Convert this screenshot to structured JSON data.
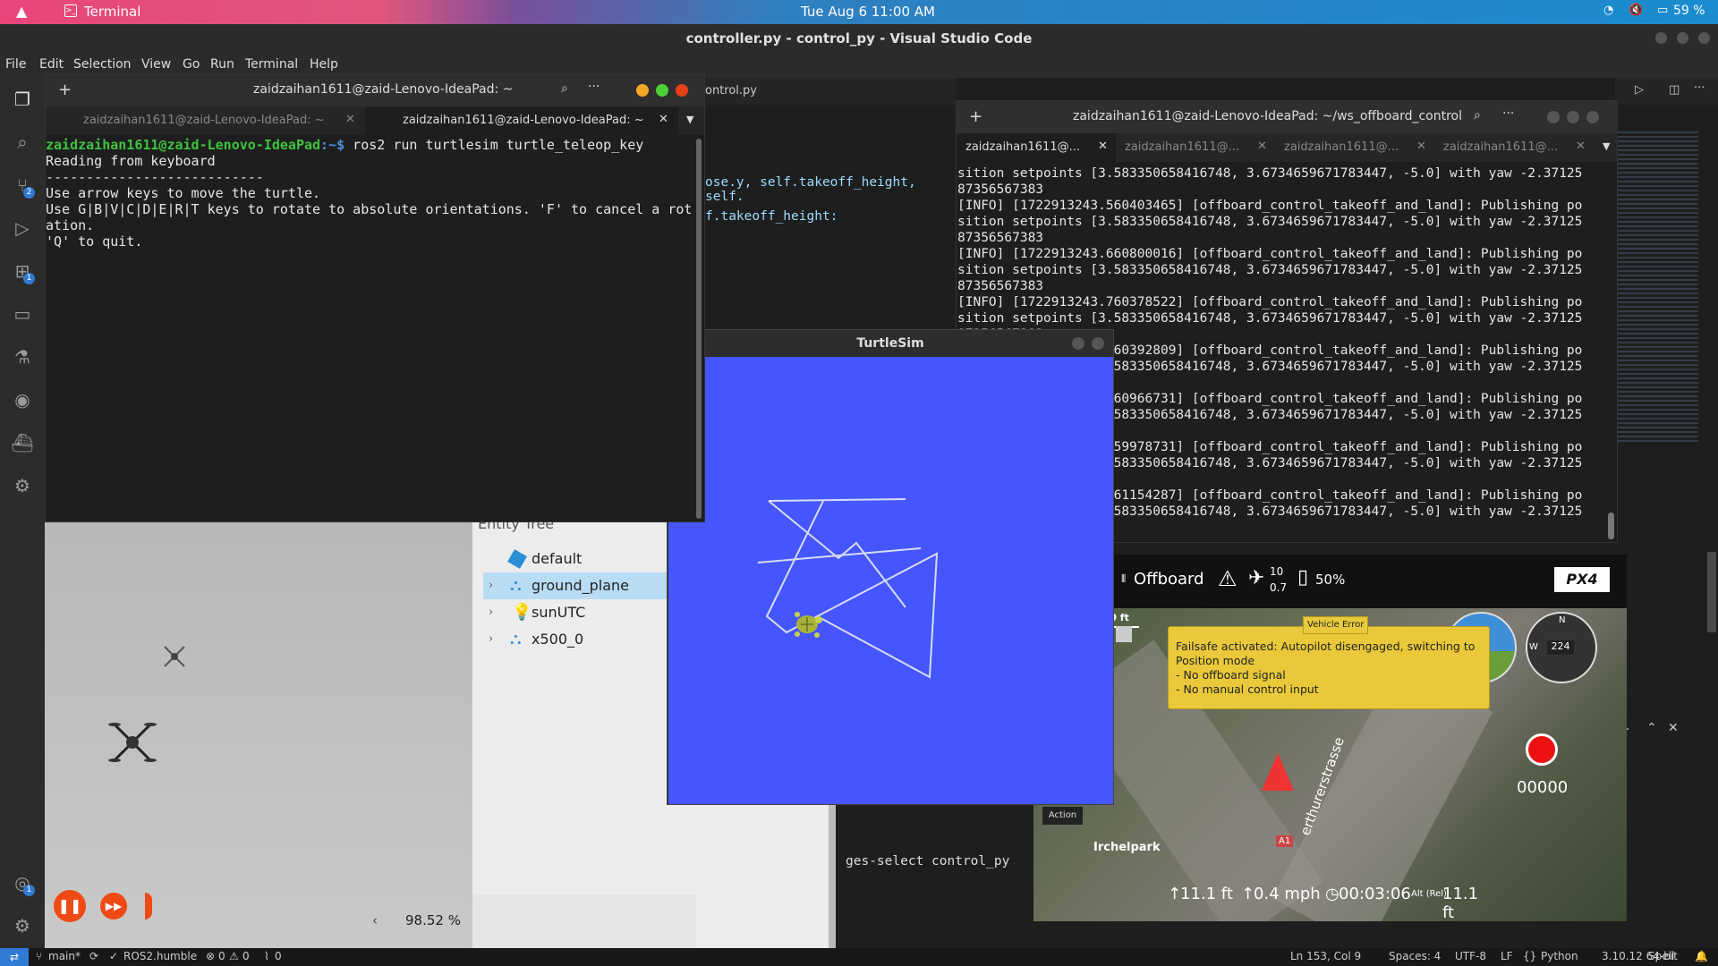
{
  "topbar": {
    "app_name": "Terminal",
    "clock": "Tue Aug 6  11:00 AM",
    "battery": "59 %"
  },
  "vscode": {
    "title": "controller.py - control_py - Visual Studio Code",
    "menu": [
      "File",
      "Edit",
      "Selection",
      "View",
      "Go",
      "Run",
      "Terminal",
      "Help"
    ],
    "tab_partial": "ontrol.py",
    "code_line1": "ose.y, self.takeoff_height, self.",
    "code_line2": "f.takeoff_height:",
    "bottom_terminal_text": "ges-select control_py",
    "activity_icons": [
      "explorer-icon",
      "search-icon",
      "source-control-icon",
      "run-debug-icon",
      "extensions-icon",
      "remote-explorer-icon",
      "testing-icon",
      "github-icon",
      "docker-icon",
      "ros-icon",
      "account-icon",
      "settings-gear-icon"
    ],
    "badges": {
      "source_control": "2",
      "extensions": "1",
      "account": "1"
    }
  },
  "terminal1": {
    "title": "zaidzaihan1611@zaid-Lenovo-IdeaPad: ~",
    "tabs": [
      {
        "label": "zaidzaihan1611@zaid-Lenovo-IdeaPad: ~",
        "active": false
      },
      {
        "label": "zaidzaihan1611@zaid-Lenovo-IdeaPad: ~",
        "active": true
      }
    ],
    "prompt_user": "zaidzaihan1611@zaid-Lenovo-IdeaPad",
    "prompt_path": ":~$",
    "command": " ros2 run turtlesim turtle_teleop_key",
    "lines": [
      "Reading from keyboard",
      "---------------------------",
      "Use arrow keys to move the turtle.",
      "Use G|B|V|C|D|E|R|T keys to rotate to absolute orientations. 'F' to cancel a rot",
      "ation.",
      "'Q' to quit."
    ]
  },
  "terminal2": {
    "title": "zaidzaihan1611@zaid-Lenovo-IdeaPad: ~/ws_offboard_control",
    "tabs": [
      "zaidzaihan1611@...",
      "zaidzaihan1611@...",
      "zaidzaihan1611@...",
      "zaidzaihan1611@..."
    ],
    "lines": [
      "sition setpoints [3.583350658416748, 3.6734659671783447, -5.0] with yaw -2.37125",
      "87356567383",
      "[INFO] [1722913243.560403465] [offboard_control_takeoff_and_land]: Publishing po",
      "sition setpoints [3.583350658416748, 3.6734659671783447, -5.0] with yaw -2.37125",
      "87356567383",
      "[INFO] [1722913243.660800016] [offboard_control_takeoff_and_land]: Publishing po",
      "sition setpoints [3.583350658416748, 3.6734659671783447, -5.0] with yaw -2.37125",
      "87356567383",
      "[INFO] [1722913243.760378522] [offboard_control_takeoff_and_land]: Publishing po",
      "sition setpoints [3.583350658416748, 3.6734659671783447, -5.0] with yaw -2.37125",
      "87356567383",
      "[INFO] [1722913243.860392809] [offboard_control_takeoff_and_land]: Publishing po",
      "sition setpoints [3.583350658416748, 3.6734659671783447, -5.0] with yaw -2.37125",
      "87356567383",
      "[INFO] [1722913243.960966731] [offboard_control_takeoff_and_land]: Publishing po",
      "sition setpoints [3.583350658416748, 3.6734659671783447, -5.0] with yaw -2.37125",
      "87356567383",
      "[INFO] [1722913244.059978731] [offboard_control_takeoff_and_land]: Publishing po",
      "sition setpoints [3.583350658416748, 3.6734659671783447, -5.0] with yaw -2.37125",
      "87356567383",
      "[INFO] [1722913244.161154287] [offboard_control_takeoff_and_land]: Publishing po",
      "sition setpoints [3.583350658416748, 3.6734659671783447, -5.0] with yaw -2.37125"
    ]
  },
  "gazebo": {
    "entity_tree_label": "Entity Tree",
    "entities": [
      {
        "label": "default",
        "icon": "world-cube-icon",
        "selected": false
      },
      {
        "label": "ground_plane",
        "icon": "model-icon",
        "selected": true
      },
      {
        "label": "sunUTC",
        "icon": "light-bulb-icon",
        "selected": false
      },
      {
        "label": "x500_0",
        "icon": "model-icon",
        "selected": false
      }
    ],
    "rtf": "98.52 %"
  },
  "turtlesim": {
    "title": "TurtleSim",
    "background": "#4556ff"
  },
  "qgc": {
    "mode": "Offboard",
    "satellites": "10",
    "hdop": "0.7",
    "battery": "50%",
    "scale": "250 ft",
    "heading": "224",
    "record_counter": "00000",
    "action_label": "Action",
    "map_labels": [
      "Irchelpark",
      "A1",
      "erthurerstrasse"
    ],
    "telemetry": {
      "altitude": "11.1 ft",
      "climb": "0.4 mph",
      "flight_time": "00:03:06",
      "alt_rel_label": "Alt (Rel)",
      "alt_rel": "11.1 ft"
    },
    "failsafe": {
      "title": "Vehicle Error",
      "message": "Failsafe activated: Autopilot disengaged, switching to Position mode",
      "item1": "- No offboard signal",
      "item2": "- No manual control input"
    }
  },
  "statusbar": {
    "branch": "main*",
    "ros": "ROS2.humble",
    "errors": "0",
    "warnings": "0",
    "ports": "0",
    "position": "Ln 153, Col 9",
    "spaces": "Spaces: 4",
    "encoding": "UTF-8",
    "eol": "LF",
    "language": "Python",
    "interpreter": "3.10.12 64-bit",
    "spell": "Spell"
  }
}
